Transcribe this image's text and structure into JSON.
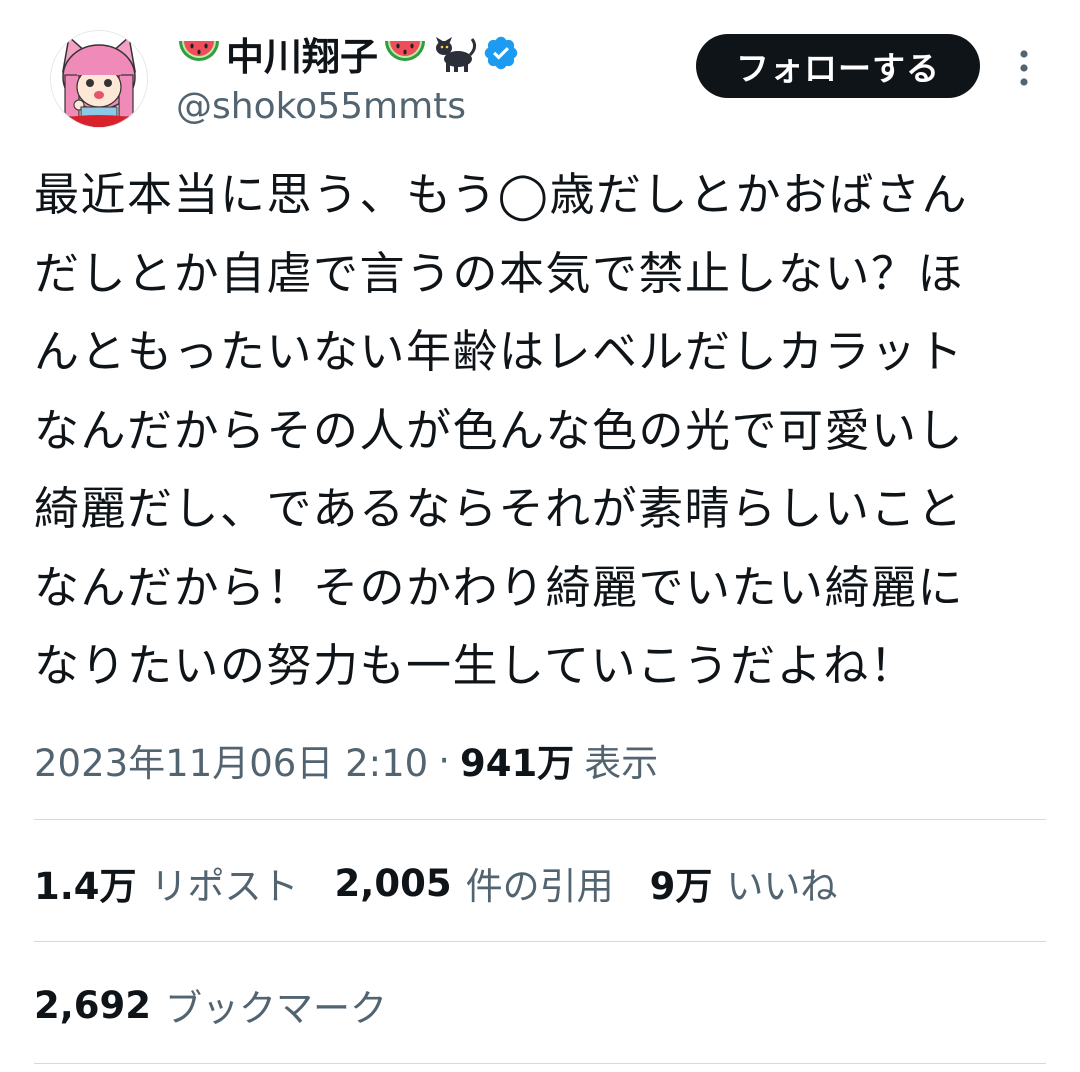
{
  "author": {
    "display_name": "中川翔子",
    "handle": "@shoko55mmts",
    "name_emoji_left": "watermelon-icon",
    "name_emoji_right": "watermelon-icon",
    "name_emoji_cat": "black-cat-icon",
    "verified": "verified-badge-icon",
    "accent_color": "#1d9bf0"
  },
  "actions": {
    "follow_label": "フォローする",
    "more_icon": "more-vertical-icon"
  },
  "tweet": {
    "text": "最近本当に思う、もう◯歳だしとかおばさん\nだしとか自虐で言うの本気で禁止しない？ほ\nんともったいない年齢はレベルだしカラット\nなんだからその人が色んな色の光で可愛いし\n綺麗だし、であるならそれが素晴らしいこと\nなんだから！そのかわり綺麗でいたい綺麗に\nなりたいの努力も一生していこうだよね！"
  },
  "meta": {
    "timestamp": "2023年11月06日 2:10",
    "separator": "·",
    "views_count": "941万",
    "views_label": "表示"
  },
  "stats": {
    "reposts_count": "1.4万",
    "reposts_label": "リポスト",
    "quotes_count": "2,005",
    "quotes_label": "件の引用",
    "likes_count": "9万",
    "likes_label": "いいね",
    "bookmarks_count": "2,692",
    "bookmarks_label": "ブックマーク"
  }
}
